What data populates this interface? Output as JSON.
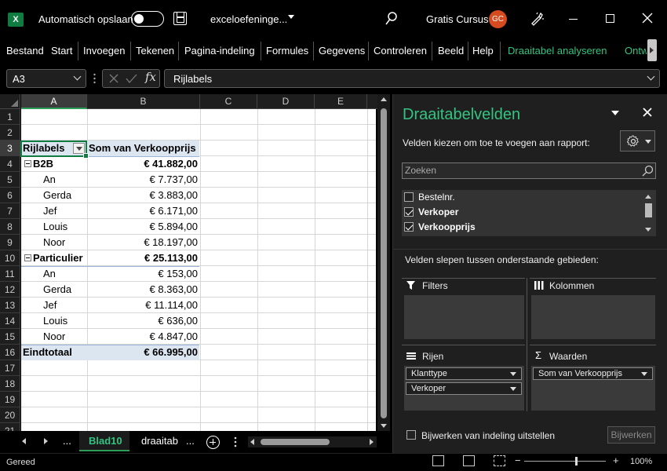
{
  "title_bar": {
    "app_icon": "X",
    "autosave_label": "Automatisch opslaan",
    "filename": "exceloefeninge...",
    "username": "Gratis Cursus",
    "avatar_initials": "GC"
  },
  "ribbon": {
    "tabs": [
      {
        "label": "Bestand"
      },
      {
        "label": "Start"
      },
      {
        "label": "Invoegen"
      },
      {
        "label": "Tekenen"
      },
      {
        "label": "Pagina-indeling"
      },
      {
        "label": "Formules"
      },
      {
        "label": "Gegevens"
      },
      {
        "label": "Controleren"
      },
      {
        "label": "Beeld"
      },
      {
        "label": "Help"
      },
      {
        "label": "Draaitabel analyseren"
      },
      {
        "label": "Ontw"
      }
    ],
    "context_color": "#33c481"
  },
  "formula_bar": {
    "name_box": "A3",
    "fx_label": "fx",
    "content": "Rijlabels"
  },
  "grid": {
    "columns": [
      "A",
      "B",
      "C",
      "D",
      "E"
    ],
    "rows": [
      "1",
      "2",
      "3",
      "4",
      "5",
      "6",
      "7",
      "8",
      "9",
      "10",
      "11",
      "12",
      "13",
      "14",
      "15",
      "16",
      "17",
      "18",
      "19",
      "20",
      "21"
    ],
    "pivot": {
      "header_label": "Rijlabels",
      "header_value": "Som van Verkoopprijs",
      "rows": [
        {
          "label": "B2B",
          "value": "€ 41.882,00",
          "group": true
        },
        {
          "label": "An",
          "value": "€ 7.737,00"
        },
        {
          "label": "Gerda",
          "value": "€ 3.883,00"
        },
        {
          "label": "Jef",
          "value": "€ 6.171,00"
        },
        {
          "label": "Louis",
          "value": "€ 5.894,00"
        },
        {
          "label": "Noor",
          "value": "€ 18.197,00"
        },
        {
          "label": "Particulier",
          "value": "€ 25.113,00",
          "group": true
        },
        {
          "label": "An",
          "value": "€ 153,00"
        },
        {
          "label": "Gerda",
          "value": "€ 8.363,00"
        },
        {
          "label": "Jef",
          "value": "€ 11.114,00"
        },
        {
          "label": "Louis",
          "value": "€ 636,00"
        },
        {
          "label": "Noor",
          "value": "€ 4.847,00"
        }
      ],
      "total_label": "Eindtotaal",
      "total_value": "€ 66.995,00"
    }
  },
  "sheets": {
    "more_left": "...",
    "active": "Blad10",
    "other": "draaitab",
    "more_right": "..."
  },
  "status": {
    "text": "Gereed",
    "zoom_minus": "−",
    "zoom_plus": "+",
    "zoom": "100%",
    "zoom_level": 0.63
  },
  "pivot_panel": {
    "title": "Draaitabelvelden",
    "subtitle": "Velden kiezen om toe te voegen aan rapport:",
    "search_placeholder": "Zoeken",
    "fields": [
      {
        "name": "Bestelnr.",
        "checked": false
      },
      {
        "name": "Verkoper",
        "checked": true
      },
      {
        "name": "Verkoopprijs",
        "checked": true
      }
    ],
    "areas_label": "Velden slepen tussen onderstaande gebieden:",
    "filters_label": "Filters",
    "columns_label": "Kolommen",
    "rows_label": "Rijen",
    "values_label": "Waarden",
    "rows_items": [
      "Klanttype",
      "Verkoper"
    ],
    "values_items": [
      "Som van Verkoopprijs"
    ],
    "defer_label": "Bijwerken van indeling uitstellen",
    "update_button": "Bijwerken"
  }
}
